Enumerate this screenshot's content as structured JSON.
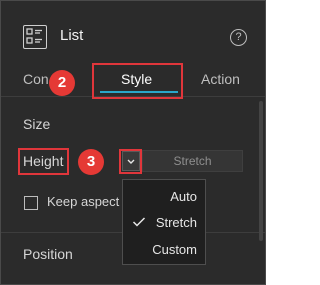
{
  "header": {
    "title": "List",
    "help_symbol": "?"
  },
  "tabs": [
    {
      "label": "Content",
      "visible_text": "Con"
    },
    {
      "label": "Style"
    },
    {
      "label": "Action"
    }
  ],
  "annotations": {
    "step_2": "2",
    "step_3": "3"
  },
  "size_section": {
    "label": "Size",
    "height_label": "Height",
    "height_value": "Stretch",
    "keep_aspect_label": "Keep aspect",
    "keep_aspect_checked": false
  },
  "position_section": {
    "label": "Position"
  },
  "height_dropdown": {
    "options": [
      "Auto",
      "Stretch",
      "Custom"
    ],
    "selected": "Stretch"
  },
  "colors": {
    "accent": "#2aa6c9",
    "highlight": "#e0363b",
    "badge": "#e53935",
    "panel": "#2b2b2b"
  }
}
